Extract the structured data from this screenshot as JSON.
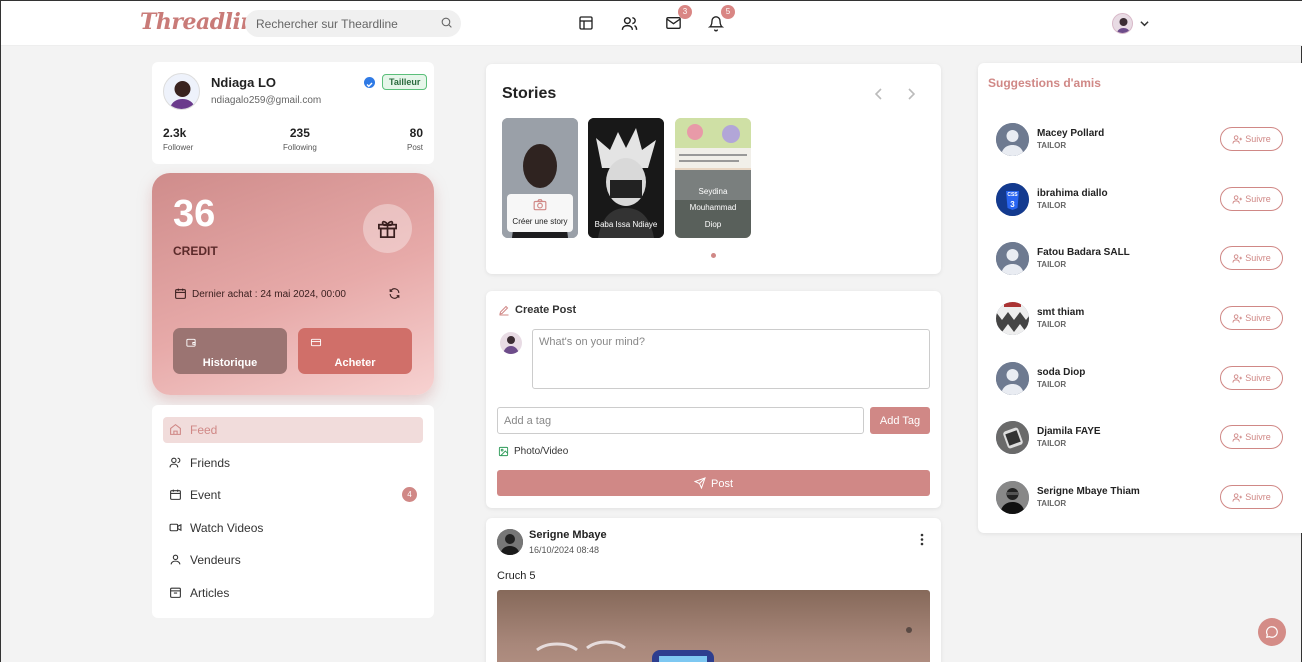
{
  "header": {
    "logo": "Threadline",
    "search_placeholder": "Rechercher sur Theardline",
    "messages_count": "3",
    "notifications_count": "5"
  },
  "profile": {
    "name": "Ndiaga LO",
    "email": "ndiagalo259@gmail.com",
    "role_badge": "Tailleur",
    "stats": [
      {
        "value": "2.3k",
        "label": "Follower"
      },
      {
        "value": "235",
        "label": "Following"
      },
      {
        "value": "80",
        "label": "Post"
      }
    ]
  },
  "credit": {
    "amount": "36",
    "label": "CREDIT",
    "last_purchase": "Dernier achat : 24 mai 2024, 00:00",
    "history_button": "Historique",
    "buy_button": "Acheter"
  },
  "menu": [
    {
      "label": "Feed",
      "icon": "home-icon",
      "active": true
    },
    {
      "label": "Friends",
      "icon": "users-icon"
    },
    {
      "label": "Event",
      "icon": "calendar-icon",
      "badge": "4"
    },
    {
      "label": "Watch Videos",
      "icon": "video-icon"
    },
    {
      "label": "Vendeurs",
      "icon": "user-icon"
    },
    {
      "label": "Articles",
      "icon": "package-icon"
    }
  ],
  "stories": {
    "title": "Stories",
    "items": [
      {
        "label": "Créer une story"
      },
      {
        "label": "Baba Issa Ndiaye"
      },
      {
        "label_lines": [
          "Seydina",
          "Mouhammad",
          "Diop"
        ]
      }
    ]
  },
  "create_post": {
    "title": "Create Post",
    "placeholder": "What's on your mind?",
    "tag_placeholder": "Add a tag",
    "add_tag_button": "Add Tag",
    "photo_video": "Photo/Video",
    "post_button": "Post"
  },
  "feed_post": {
    "author": "Serigne Mbaye",
    "date": "16/10/2024 08:48",
    "text": "Cruch 5"
  },
  "suggestions": {
    "title": "Suggestions d'amis",
    "follow_label": "Suivre",
    "items": [
      {
        "name": "Macey Pollard",
        "role": "TAILOR"
      },
      {
        "name": "ibrahima diallo",
        "role": "TAILOR"
      },
      {
        "name": "Fatou Badara SALL",
        "role": "TAILOR"
      },
      {
        "name": "smt thiam",
        "role": "TAILOR"
      },
      {
        "name": "soda Diop",
        "role": "TAILOR"
      },
      {
        "name": "Djamila FAYE",
        "role": "TAILOR"
      },
      {
        "name": "Serigne Mbaye Thiam",
        "role": "TAILOR"
      }
    ]
  },
  "colors": {
    "accent": "#d08886",
    "logo": "#c97b78",
    "verified": "#2f7ae5"
  }
}
